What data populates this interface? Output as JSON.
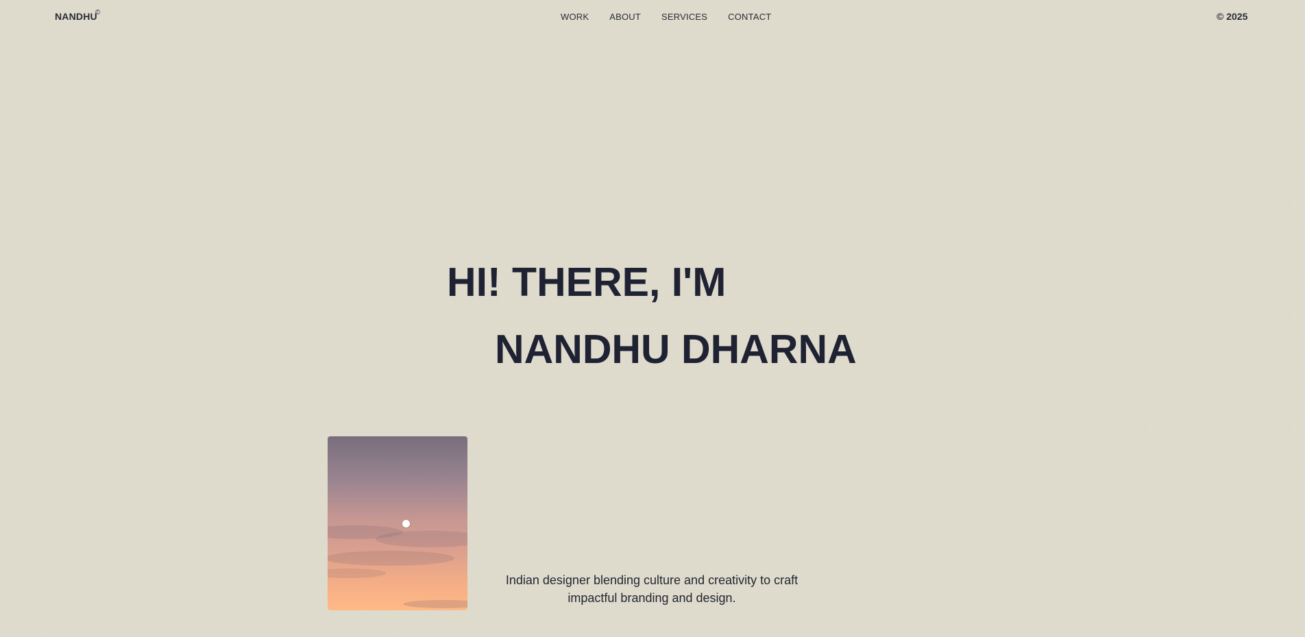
{
  "header": {
    "logo": "NANDHU",
    "logo_mark": "©",
    "nav": [
      "WORK",
      "ABOUT",
      "SERVICES",
      "CONTACT"
    ],
    "year": "© 2025"
  },
  "hero": {
    "line1": "HI! THERE, I'M",
    "line2": "NANDHU DHARNA"
  },
  "intro": {
    "tagline": "Indian designer blending culture and creativity to craft impactful branding and design."
  }
}
